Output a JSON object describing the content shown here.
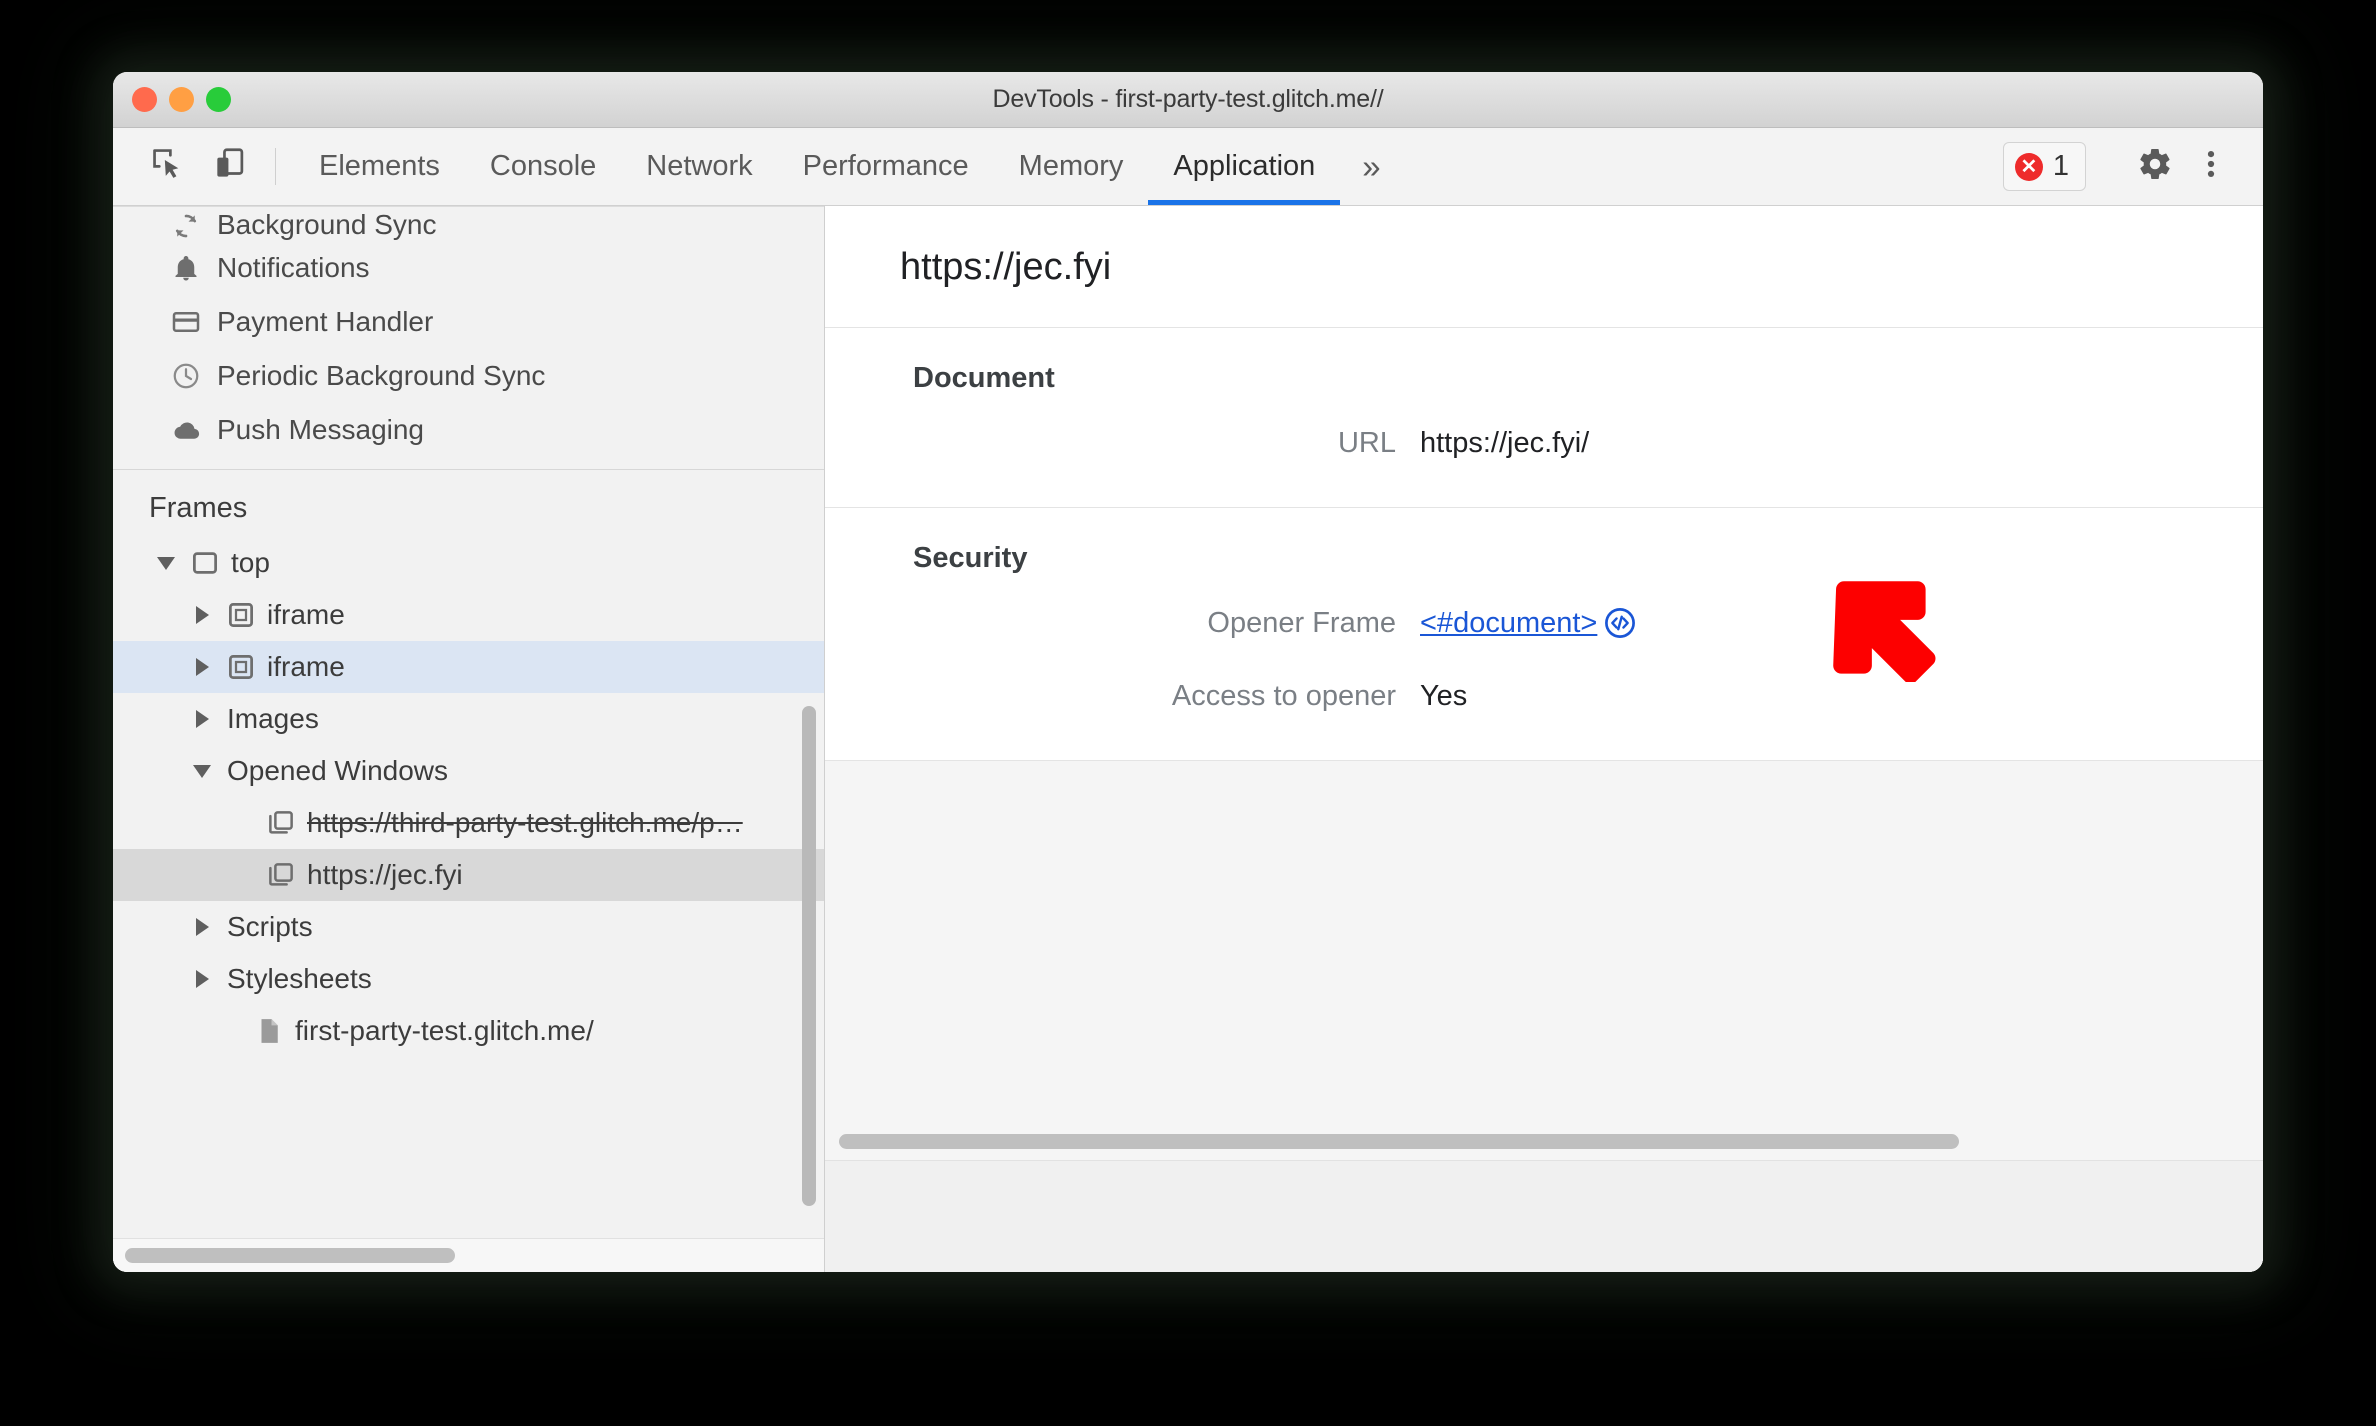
{
  "window": {
    "title": "DevTools - first-party-test.glitch.me//",
    "traffic_lights": [
      "close",
      "minimize",
      "maximize"
    ]
  },
  "toolbar": {
    "inspect_icon": "inspect-cursor-icon",
    "device_icon": "device-toolbar-icon",
    "tabs": [
      {
        "label": "Elements",
        "active": false
      },
      {
        "label": "Console",
        "active": false
      },
      {
        "label": "Network",
        "active": false
      },
      {
        "label": "Performance",
        "active": false
      },
      {
        "label": "Memory",
        "active": false
      },
      {
        "label": "Application",
        "active": true
      }
    ],
    "more_tabs_label": "»",
    "error_badge": {
      "icon": "error-circle-icon",
      "count": "1"
    },
    "settings_icon": "gear-icon",
    "menu_icon": "kebab-menu-icon",
    "accent_color": "#1a73e8",
    "error_color": "#ee2b2b"
  },
  "sidebar": {
    "background_services": [
      {
        "label": "Background Sync",
        "icon": "sync-icon"
      },
      {
        "label": "Notifications",
        "icon": "bell-icon"
      },
      {
        "label": "Payment Handler",
        "icon": "credit-card-icon"
      },
      {
        "label": "Periodic Background Sync",
        "icon": "clock-icon"
      },
      {
        "label": "Push Messaging",
        "icon": "cloud-icon"
      }
    ],
    "frames_header": "Frames",
    "tree": [
      {
        "label": "top",
        "icon": "frame-icon",
        "twisty": "down",
        "indent": 0,
        "selected": "none",
        "strike": false
      },
      {
        "label": "iframe",
        "icon": "iframe-icon",
        "twisty": "right",
        "indent": 1,
        "selected": "none",
        "strike": false
      },
      {
        "label": "iframe",
        "icon": "iframe-icon",
        "twisty": "right",
        "indent": 1,
        "selected": "focus",
        "strike": false
      },
      {
        "label": "Images",
        "icon": "none",
        "twisty": "right",
        "indent": 1,
        "selected": "none",
        "strike": false
      },
      {
        "label": "Opened Windows",
        "icon": "none",
        "twisty": "down",
        "indent": 1,
        "selected": "none",
        "strike": false
      },
      {
        "label": "https://third-party-test.glitch.me/p…",
        "icon": "window-icon",
        "twisty": "none",
        "indent": 2,
        "selected": "none",
        "strike": true
      },
      {
        "label": "https://jec.fyi",
        "icon": "window-icon",
        "twisty": "none",
        "indent": 2,
        "selected": "blur",
        "strike": false
      },
      {
        "label": "Scripts",
        "icon": "none",
        "twisty": "right",
        "indent": 1,
        "selected": "none",
        "strike": false
      },
      {
        "label": "Stylesheets",
        "icon": "none",
        "twisty": "right",
        "indent": 1,
        "selected": "none",
        "strike": false
      },
      {
        "label": "first-party-test.glitch.me/",
        "icon": "document-icon",
        "twisty": "none",
        "indent": 2,
        "selected": "none",
        "strike": false
      }
    ]
  },
  "main": {
    "header_url": "https://jec.fyi",
    "sections": [
      {
        "title": "Document",
        "fields": [
          {
            "label": "URL",
            "value": "https://jec.fyi/",
            "type": "text"
          }
        ]
      },
      {
        "title": "Security",
        "fields": [
          {
            "label": "Opener Frame",
            "value": "<#document>",
            "type": "link",
            "trailing_icon": "code-icon"
          },
          {
            "label": "Access to opener",
            "value": "Yes",
            "type": "text"
          }
        ]
      }
    ],
    "link_color": "#1a56d6"
  },
  "annotation": {
    "arrow": "red-arrow-pointing-down-left",
    "color": "#fd0000"
  }
}
